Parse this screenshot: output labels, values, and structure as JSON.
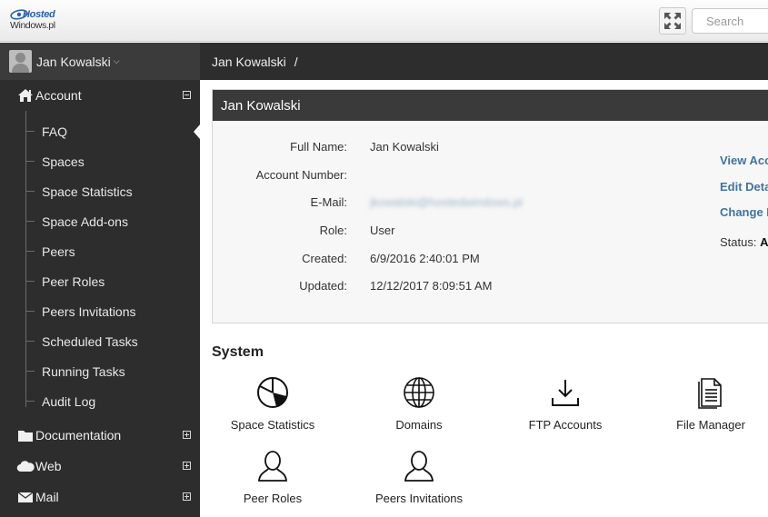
{
  "header": {
    "logo_line1": "Hosted",
    "logo_line2": "Windows.pl",
    "search_placeholder": "Search"
  },
  "sidebar": {
    "user_name": "Jan Kowalski",
    "sections": [
      {
        "label": "Account",
        "icon": "home-icon",
        "expanded": true
      },
      {
        "label": "Documentation",
        "icon": "folder-icon",
        "expanded": false
      },
      {
        "label": "Web",
        "icon": "cloud-icon",
        "expanded": false
      },
      {
        "label": "Mail",
        "icon": "envelope-icon",
        "expanded": false
      }
    ],
    "account_items": [
      {
        "label": "FAQ",
        "active": true
      },
      {
        "label": "Spaces"
      },
      {
        "label": "Space Statistics"
      },
      {
        "label": "Space Add-ons"
      },
      {
        "label": "Peers"
      },
      {
        "label": "Peer Roles"
      },
      {
        "label": "Peers Invitations"
      },
      {
        "label": "Scheduled Tasks"
      },
      {
        "label": "Running Tasks"
      },
      {
        "label": "Audit Log"
      }
    ]
  },
  "breadcrumb": {
    "current": "Jan Kowalski",
    "separator": "/"
  },
  "account_panel": {
    "title": "Jan Kowalski",
    "fields": [
      {
        "label": "Full Name:",
        "value": "Jan Kowalski"
      },
      {
        "label": "Account Number:",
        "value": ""
      },
      {
        "label": "E-Mail:",
        "value": "jkowalski@hostedwindows.pl",
        "blurred": true
      },
      {
        "label": "Role:",
        "value": "User"
      },
      {
        "label": "Created:",
        "value": "6/9/2016 2:40:01 PM"
      },
      {
        "label": "Updated:",
        "value": "12/12/2017 8:09:51 AM"
      }
    ],
    "actions": [
      "View Acc",
      "Edit Deta",
      "Change P"
    ],
    "status_label": "Status:",
    "status_value": "Ac"
  },
  "system": {
    "title": "System",
    "tiles": [
      {
        "label": "Space Statistics",
        "icon": "pie-chart-icon"
      },
      {
        "label": "Domains",
        "icon": "globe-icon"
      },
      {
        "label": "FTP Accounts",
        "icon": "download-icon"
      },
      {
        "label": "File Manager",
        "icon": "document-icon"
      },
      {
        "label": "Peer Roles",
        "icon": "user-icon"
      },
      {
        "label": "Peers Invitations",
        "icon": "user-icon"
      }
    ]
  },
  "colors": {
    "sidebar_bg": "#2d2d2d",
    "panel_header_bg": "#3a3a3a",
    "link": "#41739e"
  }
}
